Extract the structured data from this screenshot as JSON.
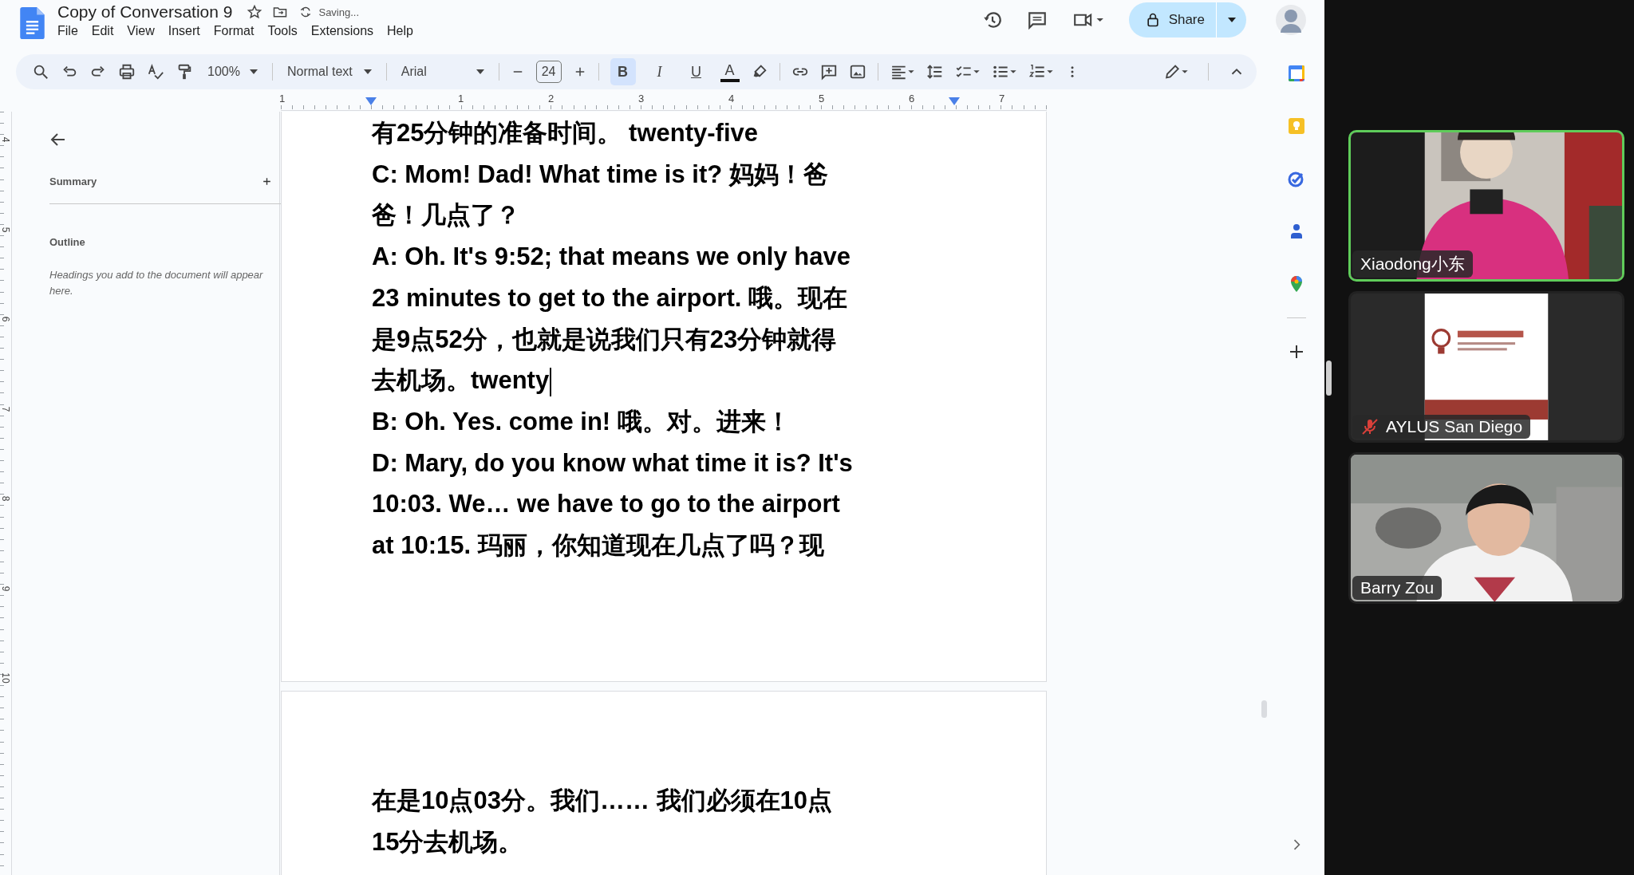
{
  "document": {
    "title": "Copy of Conversation 9",
    "status": "Saving..."
  },
  "menu": [
    "File",
    "Edit",
    "View",
    "Insert",
    "Format",
    "Tools",
    "Extensions",
    "Help"
  ],
  "share": {
    "label": "Share"
  },
  "toolbar": {
    "zoom": "100%",
    "style": "Normal text",
    "font": "Arial",
    "font_size": "24",
    "format": [
      {
        "label": "B",
        "kind": "bold",
        "selected": true
      },
      {
        "label": "I",
        "kind": "italic",
        "selected": false
      },
      {
        "label": "U",
        "kind": "underline",
        "selected": false
      },
      {
        "label": "A",
        "kind": "color",
        "selected": false
      }
    ]
  },
  "ruler": {
    "labels": [
      "1",
      "1",
      "2",
      "3",
      "4",
      "5",
      "6",
      "7"
    ]
  },
  "vertical_ruler": [
    "4",
    "5",
    "6",
    "7",
    "8",
    "9",
    "10"
  ],
  "sidebar": {
    "summary": "Summary",
    "outline": "Outline",
    "hint": "Headings you add to the document will appear here."
  },
  "pages": [
    {
      "paragraphs": [
        {
          "lines": [
            "有25分钟的准备时间。 twenty-five"
          ],
          "cursor": false
        },
        {
          "lines": [
            "C: Mom! Dad! What time is it? 妈妈！爸",
            "爸！几点了？"
          ],
          "cursor": false
        },
        {
          "lines": [
            "A: Oh. It's 9:52; that means we only have",
            "23 minutes to get to the airport. 哦。现在",
            "是9点52分，也就是说我们只有23分钟就得",
            "去机场。twenty"
          ],
          "cursor": true
        },
        {
          "lines": [
            "B: Oh. Yes. come in! 哦。对。进来！"
          ],
          "cursor": false
        },
        {
          "lines": [
            "D: Mary, do you know what time it is? It's",
            "10:03. We… we have to go to the airport",
            "at 10:15.  玛丽，你知道现在几点了吗？现"
          ],
          "cursor": false
        }
      ]
    },
    {
      "paragraphs": [
        {
          "lines": [
            "在是10点03分。我们…… 我们必须在10点",
            "15分去机场。"
          ],
          "cursor": false
        }
      ]
    }
  ],
  "participants": [
    {
      "name": "Xiaodong小东",
      "kind": "camera",
      "speaking": true,
      "muted": false
    },
    {
      "name": "AYLUS San Diego",
      "kind": "slide",
      "speaking": false,
      "muted": true
    },
    {
      "name": "Barry Zou",
      "kind": "camera2",
      "speaking": false,
      "muted": false
    }
  ]
}
